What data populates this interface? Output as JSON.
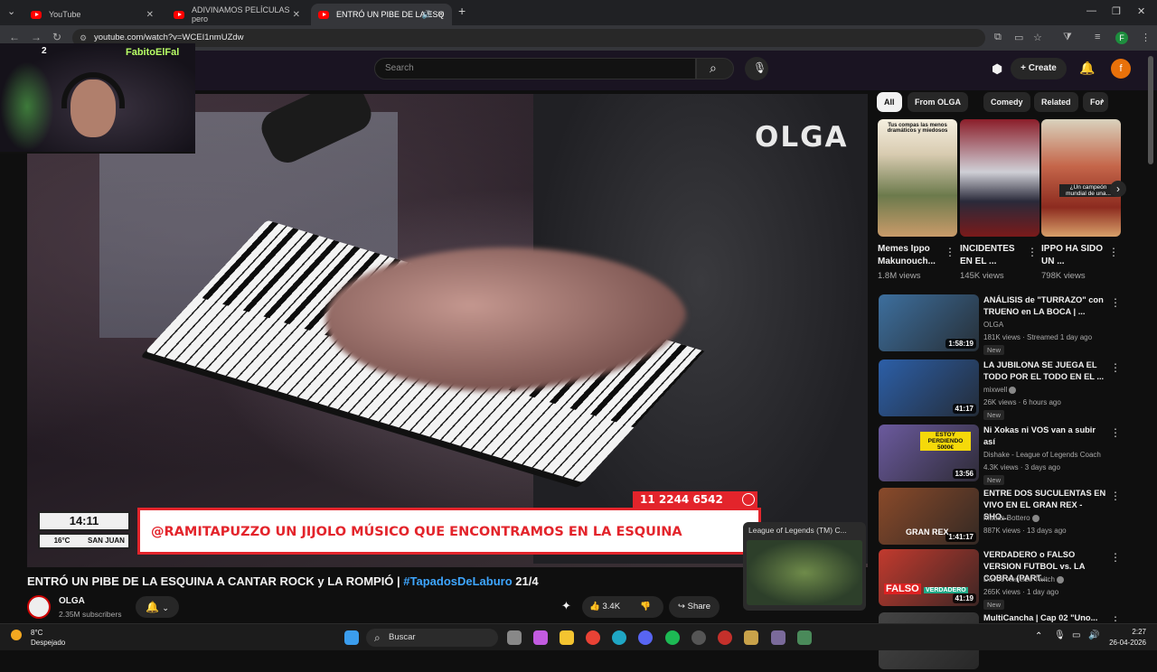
{
  "browser": {
    "tabs": [
      {
        "title": "YouTube"
      },
      {
        "title": "ADIVINAMOS PELÍCULAS pero"
      },
      {
        "title": "ENTRÓ UN PIBE DE LA ESQ"
      }
    ],
    "url": "youtube.com/watch?v=WCEI1nmUZdw",
    "profile_initial": "F"
  },
  "youtube": {
    "search_placeholder": "Search",
    "create_label": "Create",
    "avatar_initial": "f"
  },
  "stream_overlay": {
    "streamer_name": "FabitoElFal",
    "viewer_count": "2"
  },
  "video": {
    "logo": "OLGA",
    "phone": "11 2244 6542",
    "ticker": "@RAMITAPUZZO UN JIJOLO MÚSICO QUE ENCONTRAMOS EN LA ESQUINA",
    "clock": "14:11",
    "temp": "16°C",
    "city": "SAN JUAN",
    "title_main": "ENTRÓ UN PIBE DE LA ESQUINA A CANTAR ROCK y LA ROMPIÓ | ",
    "title_tag": "#TapadosDeLaburo",
    "title_end": " 21/4",
    "channel": "OLGA",
    "subscribers": "2.35M subscribers",
    "likes": "3.4K",
    "share": "Share"
  },
  "miniplayer": {
    "title": "League of Legends (TM) C..."
  },
  "chips": [
    "All",
    "From OLGA",
    "Comedy",
    "Related",
    "For"
  ],
  "shorts": [
    {
      "title": "Memes Ippo Makunouch...",
      "views": "1.8M views",
      "thumb_text": "Tus compas las menos dramáticos y miedosos"
    },
    {
      "title": "INCIDENTES EN EL ...",
      "views": "145K views",
      "thumb_text": ""
    },
    {
      "title": "IPPO HA SIDO UN ...",
      "views": "798K views",
      "thumb_text": "¿Un campeón mundial de una..."
    }
  ],
  "recommended": [
    {
      "title": "ANÁLISIS de \"TURRAZO\" con TRUENO en LA BOCA | ...",
      "channel": "OLGA",
      "meta": "181K views · Streamed 1 day ago",
      "badge": "New",
      "duration": "1:58:19",
      "verified": false,
      "color": "#3d6f9e"
    },
    {
      "title": "LA JUBILONA SE JUEGA EL TODO POR EL TODO EN EL ...",
      "channel": "mixwell",
      "meta": "26K views · 6 hours ago",
      "badge": "New",
      "duration": "41:17",
      "verified": true,
      "color": "#2c5fa8"
    },
    {
      "title": "Ni Xokas ni VOS van a subir así",
      "channel": "Dishake - League of Legends Coach",
      "meta": "4.3K views · 3 days ago",
      "badge": "New",
      "duration": "13:56",
      "verified": false,
      "color": "#6b5a9e"
    },
    {
      "title": "ENTRE DOS SUCULENTAS EN VIVO EN EL GRAN REX - SHO...",
      "channel": "Matias Bottero",
      "meta": "887K views · 13 days ago",
      "badge": "",
      "duration": "1:41:17",
      "verified": true,
      "color": "#8a4a2a"
    },
    {
      "title": "VERDADERO o FALSO VERSION FUTBOL vs. LA COBRA (PART...",
      "channel": "Davoo Xeneize Twitch",
      "meta": "265K views · 1 day ago",
      "badge": "New",
      "duration": "41:19",
      "verified": true,
      "color": "#c23a2e"
    },
    {
      "title": "MultiCancha | Cap 02 \"Uno...",
      "channel": "",
      "meta": "",
      "badge": "",
      "duration": "",
      "verified": false,
      "color": "#444"
    }
  ],
  "thumb_texts": {
    "rec_4": "GRAN REX",
    "rec_5_a": "FALSO",
    "rec_5_b": "VERDADERO",
    "rec_3": "ESTOY PERDIENDO 5000€"
  },
  "taskbar": {
    "weather_temp": "8°C",
    "weather_desc": "Despejado",
    "search_label": "Buscar",
    "time": "2:27",
    "date": "26-04-2026"
  },
  "colors": {
    "youtube_red": "#ff0000",
    "olga_red": "#e3242b",
    "link_blue": "#3ea6ff"
  }
}
